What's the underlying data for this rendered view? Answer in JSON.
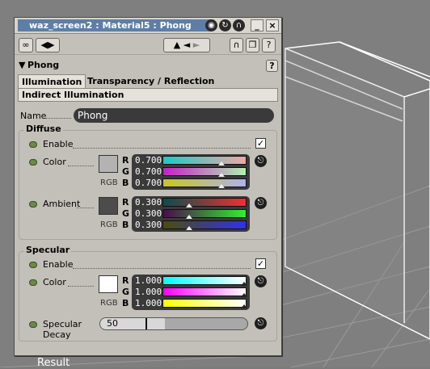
{
  "window": {
    "title": "waz_screen2 : Material5 : Phong"
  },
  "section": {
    "label": "Phong"
  },
  "tabs": [
    {
      "label": "Illumination",
      "active": true
    },
    {
      "label": "Transparency / Reflection",
      "active": false
    }
  ],
  "subtab": {
    "label": "Indirect Illumination"
  },
  "name_field": {
    "label": "Name",
    "value": "Phong"
  },
  "diffuse": {
    "title": "Diffuse",
    "enable": {
      "label": "Enable",
      "checked": true
    },
    "color": {
      "label": "Color",
      "swatch": "#b3b3b3",
      "mode_label": "RGB",
      "channels": [
        {
          "letter": "R",
          "value": "0.700"
        },
        {
          "letter": "G",
          "value": "0.700"
        },
        {
          "letter": "B",
          "value": "0.700"
        }
      ]
    },
    "ambient": {
      "label": "Ambient",
      "swatch": "#4c4c4c",
      "mode_label": "RGB",
      "channels": [
        {
          "letter": "R",
          "value": "0.300"
        },
        {
          "letter": "G",
          "value": "0.300"
        },
        {
          "letter": "B",
          "value": "0.300"
        }
      ]
    }
  },
  "specular": {
    "title": "Specular",
    "enable": {
      "label": "Enable",
      "checked": true
    },
    "color": {
      "label": "Color",
      "swatch": "#ffffff",
      "mode_label": "RGB",
      "channels": [
        {
          "letter": "R",
          "value": "1.000"
        },
        {
          "letter": "G",
          "value": "1.000"
        },
        {
          "letter": "B",
          "value": "1.000"
        }
      ]
    },
    "decay": {
      "label_line1": "Specular",
      "label_line2": "Decay",
      "value": "50"
    }
  },
  "viewport": {
    "result_label": "Result"
  },
  "icons": {
    "close": "close-icon",
    "minimize": "minimize-icon",
    "help": "help-icon",
    "link": "link-icon",
    "arrow_left": "arrow-left-icon",
    "arrow_right": "arrow-right-icon",
    "up": "up-arrow-icon",
    "back": "back-arrow-icon",
    "forward": "forward-arrow-icon"
  },
  "colors": {
    "title_bar": "#5e7ea6",
    "panel": "#c2c0b8",
    "slider_bg": "#3a3a3a",
    "led": "#6a8a46"
  }
}
